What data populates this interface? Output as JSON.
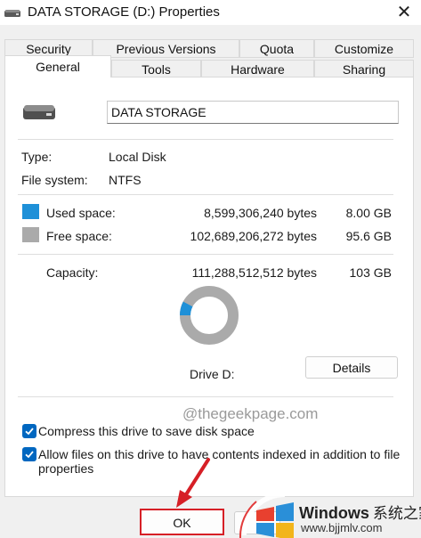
{
  "window": {
    "title": "DATA STORAGE (D:) Properties",
    "close_symbol": "✕"
  },
  "tabs": {
    "row1": [
      "Security",
      "Previous Versions",
      "Quota",
      "Customize"
    ],
    "row2": [
      "General",
      "Tools",
      "Hardware",
      "Sharing"
    ],
    "active": "General"
  },
  "general": {
    "drive_name": "DATA STORAGE",
    "type_label": "Type:",
    "type_value": "Local Disk",
    "fs_label": "File system:",
    "fs_value": "NTFS",
    "used_label": "Used space:",
    "used_bytes": "8,599,306,240 bytes",
    "used_size": "8.00 GB",
    "free_label": "Free space:",
    "free_bytes": "102,689,206,272 bytes",
    "free_size": "95.6 GB",
    "capacity_label": "Capacity:",
    "capacity_bytes": "111,288,512,512 bytes",
    "capacity_size": "103 GB",
    "used_fraction": 0.0773,
    "drive_caption": "Drive D:",
    "details_label": "Details",
    "compress_label": "Compress this drive to save disk space",
    "compress_checked": true,
    "index_label_line1": "Allow files on this drive to have contents indexed in addition to file",
    "index_label_line2": "properties",
    "index_checked": true
  },
  "footer": {
    "ok_label": "OK"
  },
  "watermarks": {
    "site": "@thegeekpage.com",
    "brand": "Windows",
    "brand_cn": "系统之家",
    "url": "www.bjjmlv.com"
  },
  "colors": {
    "used": "#1e90d8",
    "free": "#aaaaaa",
    "checkbox": "#0067c0",
    "highlight": "#d61f26"
  }
}
